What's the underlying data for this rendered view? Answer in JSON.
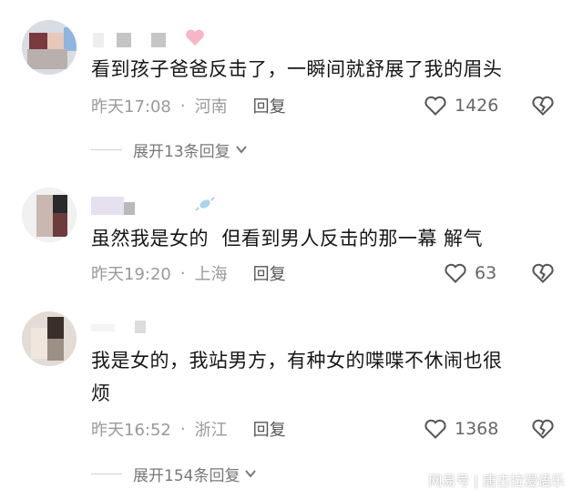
{
  "comments": [
    {
      "text": "看到孩子爸爸反击了，一瞬间就舒展了我的眉头",
      "time": "昨天17:08",
      "location": "河南",
      "reply_label": "回复",
      "likes": "1426",
      "expand_label": "展开13条回复"
    },
    {
      "text": "虽然我是女的  但看到男人反击的那一幕 解气",
      "time": "昨天19:20",
      "location": "上海",
      "reply_label": "回复",
      "likes": "63"
    },
    {
      "text_line1": "我是女的，我站男方，有种女的喋喋不休闹也很",
      "text_line2": "烦",
      "time": "昨天16:52",
      "location": "浙江",
      "reply_label": "回复",
      "likes": "1368",
      "expand_label": "展开154条回复"
    }
  ],
  "watermark": "网易号 | 唐古拉漫语乐",
  "icons": {
    "like": "heart-outline-icon",
    "dislike": "broken-heart-icon",
    "expand": "chevron-down-icon"
  }
}
